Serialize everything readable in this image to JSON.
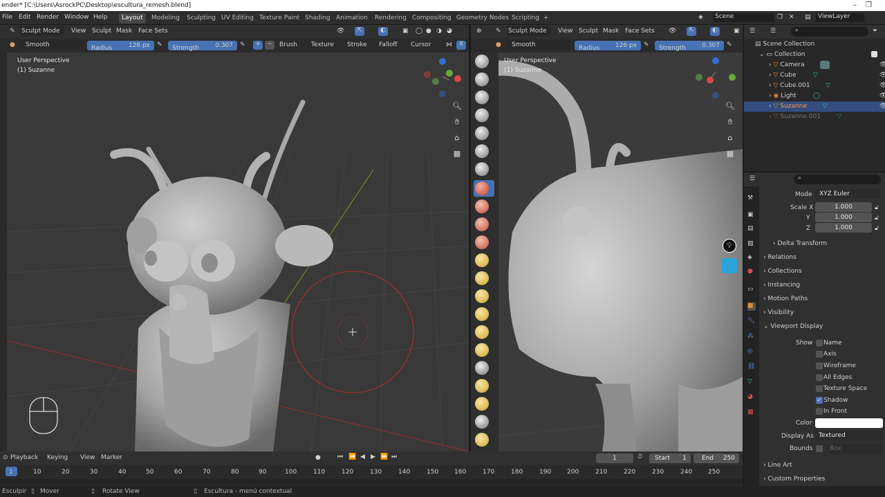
{
  "window": {
    "title": "ender* [C:\\Users\\AsrockPC\\Desktop\\escultura_remesh.blend]"
  },
  "menu": {
    "items": [
      "File",
      "Edit",
      "Render",
      "Window",
      "Help"
    ]
  },
  "workspaces": {
    "active": "Layout",
    "items": [
      "Layout",
      "Modeling",
      "Sculpting",
      "UV Editing",
      "Texture Paint",
      "Shading",
      "Animation",
      "Rendering",
      "Compositing",
      "Geometry Nodes",
      "Scripting"
    ],
    "add": "+"
  },
  "scene": {
    "label": "Scene",
    "view_layer": "ViewLayer"
  },
  "left_view": {
    "mode": "Sculpt Mode",
    "menus": [
      "View",
      "Sculpt",
      "Mask",
      "Face Sets"
    ],
    "brush": "Smooth",
    "radius_label": "Radius",
    "radius_value": "126 px",
    "strength_label": "Strength",
    "strength_value": "0.307",
    "tool_menus": [
      "Brush",
      "Texture",
      "Stroke",
      "Falloff",
      "Cursor"
    ],
    "axis": "X",
    "perspective": "User Perspective",
    "object": "(1) Suzanne"
  },
  "right_view": {
    "mode": "Sculpt Mode",
    "menus": [
      "View",
      "Sculpt",
      "Mask",
      "Face Sets"
    ],
    "brush": "Smooth",
    "radius_label": "Radius",
    "radius_value": "126 px",
    "strength_label": "Strength",
    "strength_value": "0.307",
    "perspective": "User Perspective",
    "object": "(1) Suzanne"
  },
  "outliner": {
    "root": "Scene Collection",
    "collection": "Collection",
    "items": [
      {
        "name": "Camera"
      },
      {
        "name": "Cube"
      },
      {
        "name": "Cube.001"
      },
      {
        "name": "Light"
      },
      {
        "name": "Suzanne",
        "selected": true
      },
      {
        "name": "Suzanne.001",
        "dim": true
      }
    ]
  },
  "properties": {
    "mode_label": "Mode",
    "mode_value": "XYZ Euler",
    "scale_x_label": "Scale X",
    "scale_x": "1.000",
    "scale_y_label": "Y",
    "scale_y": "1.000",
    "scale_z_label": "Z",
    "scale_z": "1.000",
    "delta": "Delta Transform",
    "sections": [
      "Relations",
      "Collections",
      "Instancing",
      "Motion Paths",
      "Visibility"
    ],
    "viewport_display": "Viewport Display",
    "show_label": "Show",
    "show_items": [
      {
        "label": "Name",
        "on": false
      },
      {
        "label": "Axis",
        "on": false
      },
      {
        "label": "Wireframe",
        "on": false
      },
      {
        "label": "All Edges",
        "on": false
      },
      {
        "label": "Texture Space",
        "on": false
      },
      {
        "label": "Shadow",
        "on": true
      },
      {
        "label": "In Front",
        "on": false
      }
    ],
    "color_label": "Color",
    "display_as_label": "Display As",
    "display_as": "Textured",
    "bounds_label": "Bounds",
    "bounds_value": "Box",
    "line_art": "Line Art",
    "custom_props": "Custom Properties"
  },
  "timeline": {
    "menus": [
      "Playback",
      "Keying",
      "View",
      "Marker"
    ],
    "current_frame": "1",
    "start_label": "Start",
    "start": "1",
    "end_label": "End",
    "end": "250",
    "ticks": [
      "1",
      "10",
      "20",
      "30",
      "40",
      "50",
      "60",
      "70",
      "80",
      "90",
      "100",
      "110",
      "120",
      "130",
      "140",
      "150",
      "160",
      "170",
      "180",
      "190",
      "200",
      "210",
      "220",
      "230",
      "240",
      "250"
    ]
  },
  "status": {
    "items": [
      "Esculpir",
      "Mover",
      "Rotate View",
      "Escultura - menú contextual"
    ]
  },
  "colors": {
    "accent": "#4772b3",
    "selected_row": "#334d80",
    "brush_circle": "#b33030"
  }
}
